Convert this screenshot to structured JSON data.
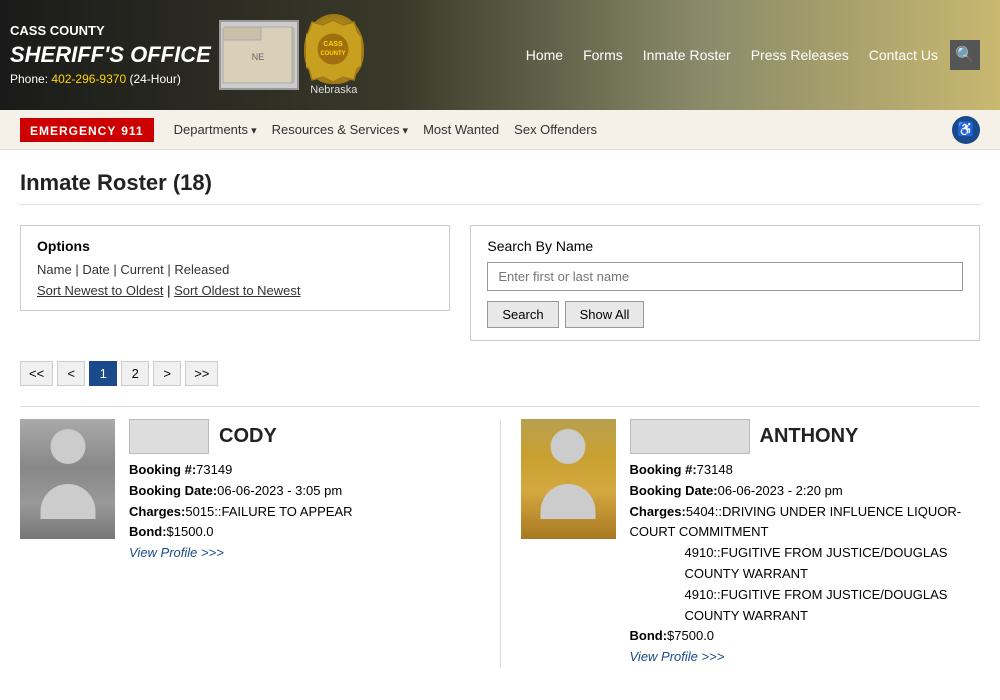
{
  "header": {
    "office_name_line1": "CASS COUNTY",
    "office_name_line2": "SHERIFF'S OFFICE",
    "phone_label": "Phone:",
    "phone_number": "402-296-9370",
    "phone_extra": "(24-Hour)",
    "nebraska_label": "Nebraska",
    "badge_label": "CASS CO",
    "nav_links": [
      {
        "label": "Home",
        "href": "#"
      },
      {
        "label": "Forms",
        "href": "#"
      },
      {
        "label": "Inmate Roster",
        "href": "#"
      },
      {
        "label": "Press Releases",
        "href": "#"
      },
      {
        "label": "Contact Us",
        "href": "#"
      }
    ],
    "emergency": "EMERGENCY",
    "emergency_911": "911",
    "secondary_nav": [
      {
        "label": "Departments",
        "dropdown": true
      },
      {
        "label": "Resources & Services",
        "dropdown": true
      },
      {
        "label": "Most Wanted",
        "dropdown": false
      },
      {
        "label": "Sex Offenders",
        "dropdown": false
      }
    ]
  },
  "page": {
    "title": "Inmate Roster (18)"
  },
  "options": {
    "title": "Options",
    "filter_links": [
      {
        "label": "Name"
      },
      {
        "label": "Date"
      },
      {
        "label": "Current"
      },
      {
        "label": "Released"
      }
    ],
    "sort_links": [
      {
        "label": "Sort Newest to Oldest"
      },
      {
        "label": "Sort Oldest to Newest"
      }
    ]
  },
  "search": {
    "label": "Search By Name",
    "placeholder": "Enter first or last name",
    "search_btn": "Search",
    "show_all_btn": "Show All"
  },
  "pagination": {
    "first": "<<",
    "prev": "<",
    "pages": [
      "1",
      "2"
    ],
    "next": ">",
    "last": ">>",
    "current_page": "1"
  },
  "inmates": [
    {
      "id": "inmate-1",
      "first_name_box": "",
      "last_name": "CODY",
      "booking_number": "73149",
      "booking_date": "06-06-2023 - 3:05 pm",
      "charges": [
        "5015::FAILURE TO APPEAR"
      ],
      "bond": "$1500.0",
      "view_profile_label": "View Profile >>>"
    },
    {
      "id": "inmate-2",
      "first_name_box": "",
      "last_name": "ANTHONY",
      "booking_number": "73148",
      "booking_date": "06-06-2023 - 2:20 pm",
      "charges": [
        "5404::DRIVING UNDER INFLUENCE LIQUOR-COURT COMMITMENT",
        "4910::FUGITIVE FROM JUSTICE/DOUGLAS COUNTY WARRANT",
        "4910::FUGITIVE FROM JUSTICE/DOUGLAS COUNTY WARRANT"
      ],
      "bond": "$7500.0",
      "view_profile_label": "View Profile >>>"
    }
  ],
  "labels": {
    "booking_num": "Booking #:",
    "booking_date": "Booking Date:",
    "charges": "Charges:",
    "bond": "Bond:"
  }
}
